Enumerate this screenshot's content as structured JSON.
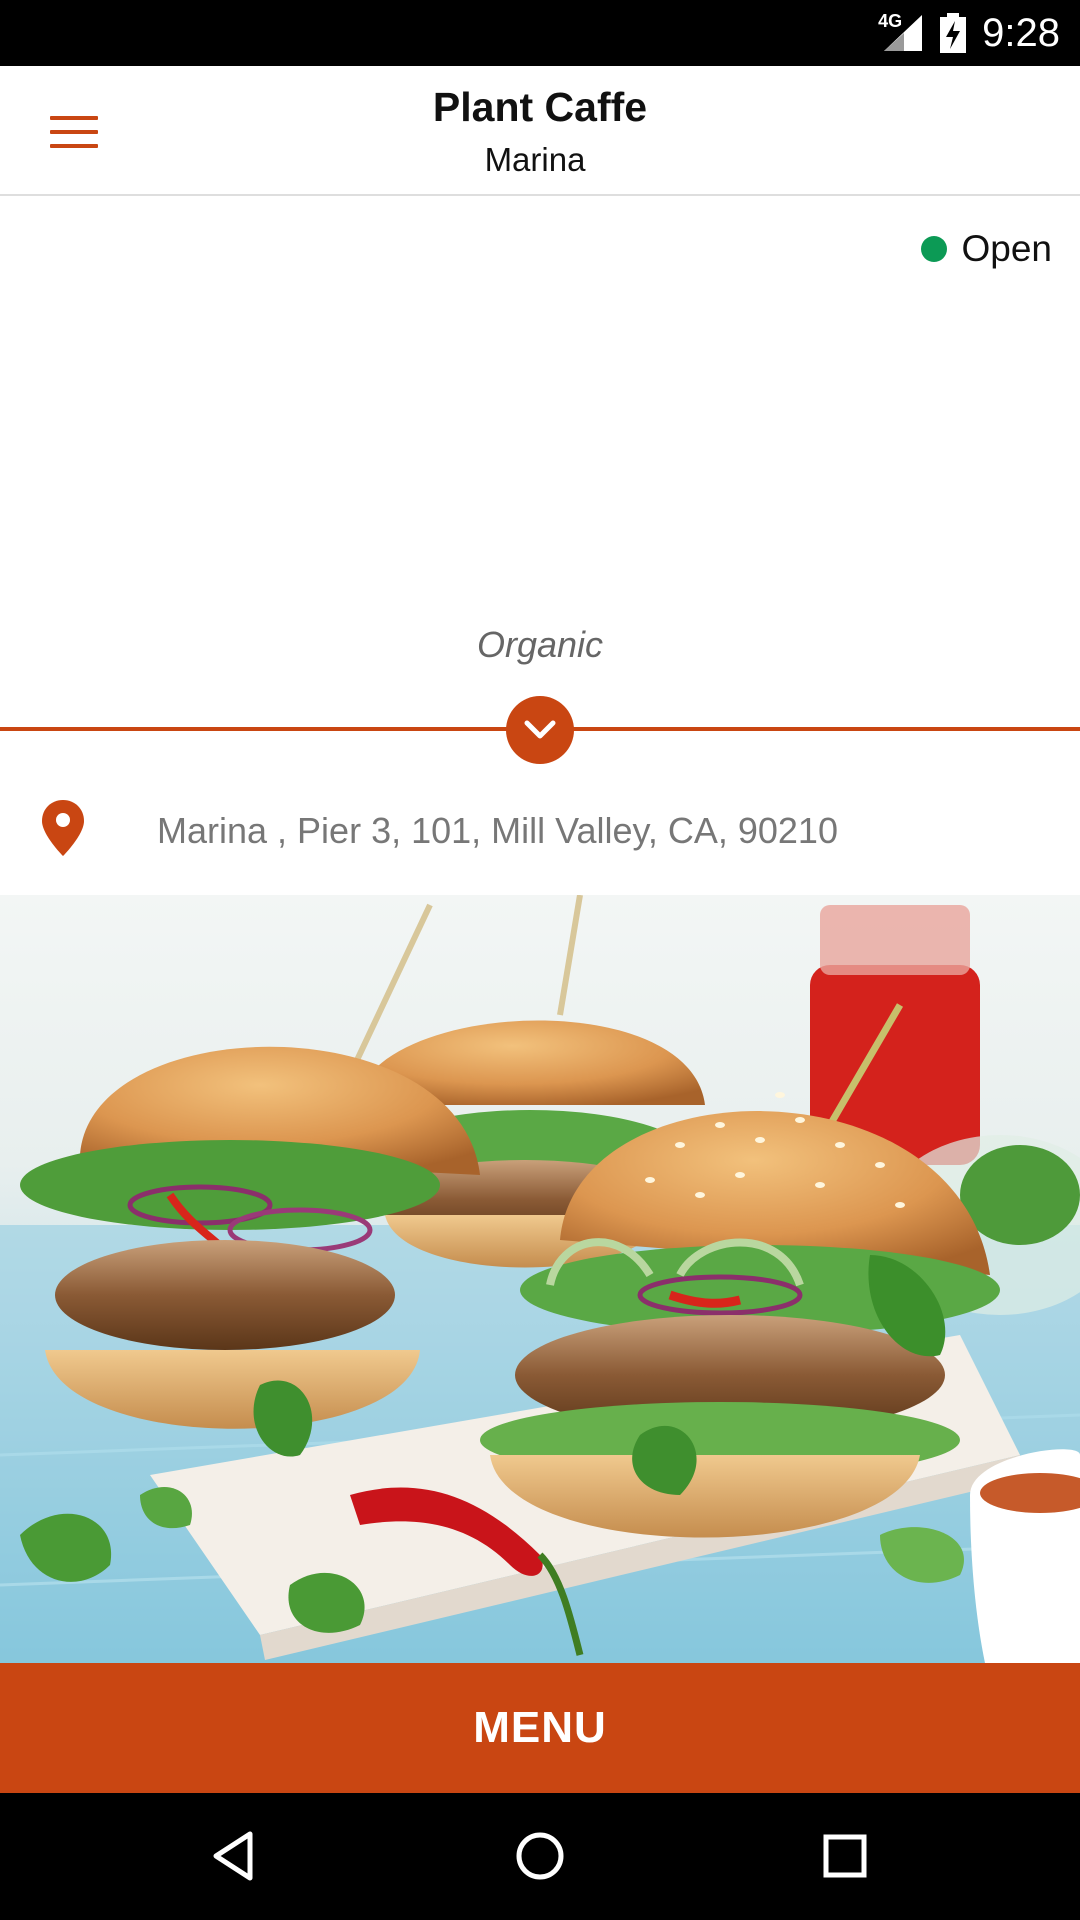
{
  "status_bar": {
    "network": "4G",
    "time": "9:28"
  },
  "app_bar": {
    "title": "Plant Caffe",
    "subtitle": "Marina",
    "menu_icon": "hamburger-icon"
  },
  "store_status": {
    "label": "Open",
    "color": "#0c9a55"
  },
  "tagline": "Organic",
  "address": {
    "icon": "location-pin-icon",
    "text": "Marina , Pier 3, 101, Mill Valley, CA, 90210"
  },
  "hero_image": {
    "subject": "burgers-photo"
  },
  "menu_button": {
    "label": "MENU"
  },
  "nav_bar": {
    "back_icon": "back-triangle-icon",
    "home_icon": "home-circle-icon",
    "recents_icon": "recents-square-icon"
  },
  "colors": {
    "accent": "#c94612",
    "status_open": "#0c9a55",
    "address_text": "#777777"
  }
}
